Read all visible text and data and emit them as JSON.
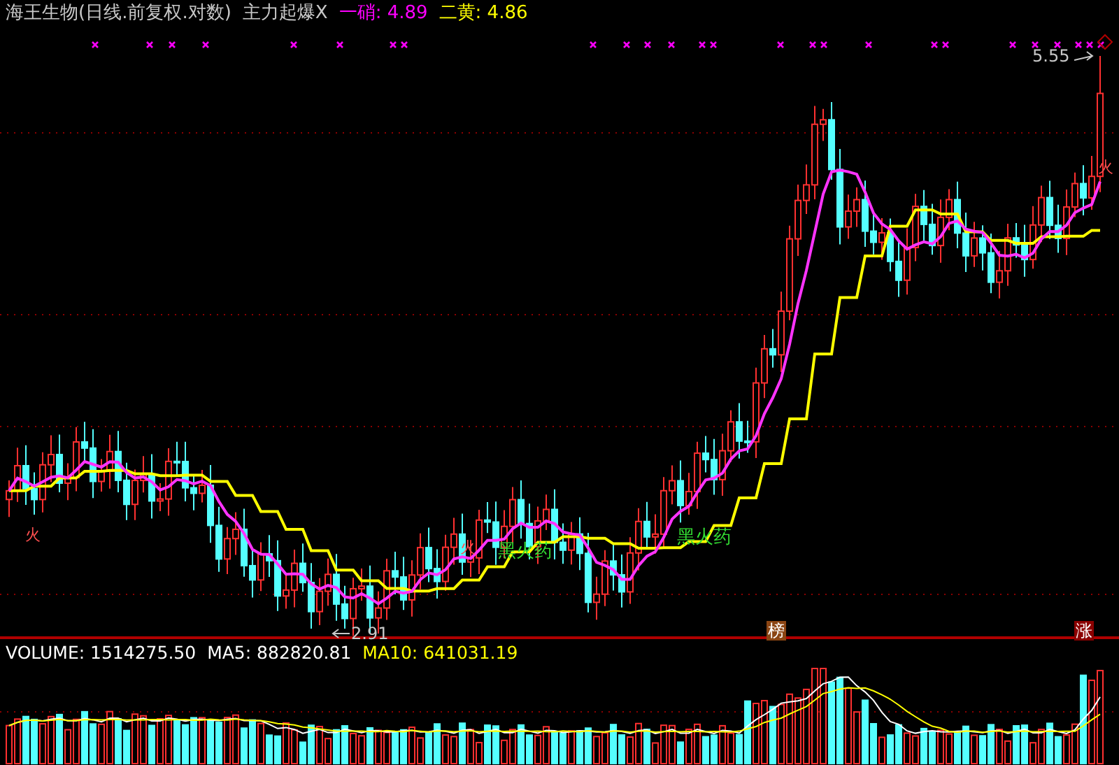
{
  "header": {
    "title": "海王生物(日线.前复权.对数)",
    "indicator": "主力起爆X",
    "legend": [
      {
        "label": "一硝: 4.89",
        "color": "#ff00ff"
      },
      {
        "label": "二黄: 4.86",
        "color": "#ffff00"
      }
    ]
  },
  "annotations": [
    {
      "kind": "high",
      "text": "5.55"
    },
    {
      "kind": "low",
      "text": "2.91"
    },
    {
      "kind": "signal",
      "text": "黑火药"
    },
    {
      "kind": "signal",
      "text": "黑火药"
    },
    {
      "kind": "fire",
      "text": "火"
    },
    {
      "kind": "fire",
      "text": "火"
    },
    {
      "kind": "fire",
      "text": "火"
    },
    {
      "kind": "badge",
      "text": "榜",
      "color": "#8b4513"
    },
    {
      "kind": "badge",
      "text": "涨",
      "color": "#8b0000"
    }
  ],
  "volume_panel": {
    "legend": [
      {
        "label": "VOLUME: 1514275.50",
        "color": "#ffffff"
      },
      {
        "label": "MA5: 882820.81",
        "color": "#ffffff"
      },
      {
        "label": "MA10: 641031.19",
        "color": "#ffff00"
      }
    ]
  }
}
